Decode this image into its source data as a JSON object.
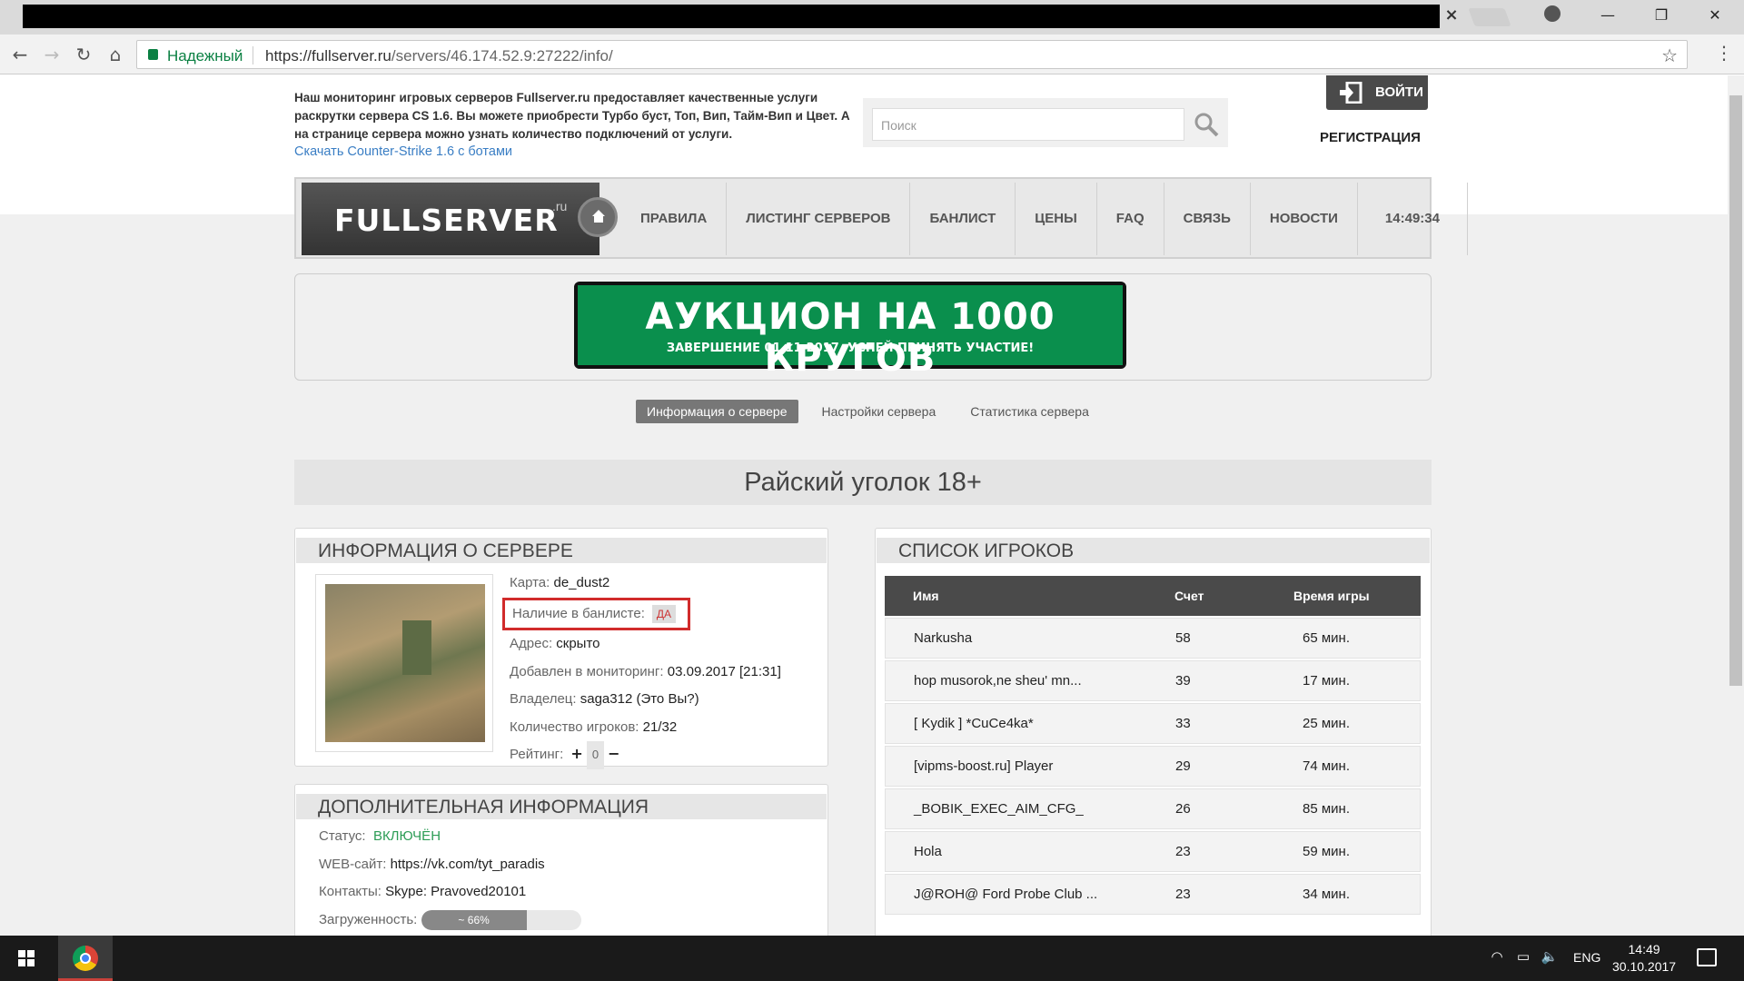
{
  "browser": {
    "secure_label": "Надежный",
    "url_host": "https://fullserver.ru",
    "url_path": "/servers/46.174.52.9:27222/info/",
    "tab_close": "×"
  },
  "header": {
    "intro": "Наш мониторинг игровых серверов Fullserver.ru предоставляет качественные услуги раскрутки сервера CS 1.6. Вы можете приобрести Турбо буст, Топ, Вип, Тайм-Вип и Цвет. А на странице сервера можно узнать количество подключений от услуги.",
    "download_link": "Скачать Counter-Strike 1.6 с ботами",
    "search_placeholder": "Поиск",
    "login_label": "ВОЙТИ",
    "register_label": "РЕГИСТРАЦИЯ"
  },
  "nav": {
    "logo": "FULLSERVER",
    "logo_sup": ".ru",
    "items": [
      "ПРАВИЛА",
      "ЛИСТИНГ СЕРВЕРОВ",
      "БАНЛИСТ",
      "ЦЕНЫ",
      "FAQ",
      "СВЯЗЬ",
      "НОВОСТИ"
    ],
    "clock": "14:49:34"
  },
  "banner": {
    "title": "АУКЦИОН НА 1000 КРУГОВ",
    "subtitle": "ЗАВЕРШЕНИЕ 01.11.2017. УСПЕЙ ПРИНЯТЬ УЧАСТИЕ!"
  },
  "tabs": {
    "info": "Информация о сервере",
    "settings": "Настройки сервера",
    "stats": "Статистика сервера"
  },
  "server": {
    "name": "Райский уголок 18+",
    "info_title": "ИНФОРМАЦИЯ О СЕРВЕРЕ",
    "map_label": "Карта:",
    "map": "de_dust2",
    "banlist_label": "Наличие в банлисте:",
    "banlist": "ДА",
    "address_label": "Адрес:",
    "address": "скрыто",
    "added_label": "Добавлен в мониторинг:",
    "added": "03.09.2017 [21:31]",
    "owner_label": "Владелец:",
    "owner": "saga312 (Это Вы?)",
    "players_label": "Количество игроков:",
    "players": "21/32",
    "rating_label": "Рейтинг:",
    "rating": "0"
  },
  "extra": {
    "title": "ДОПОЛНИТЕЛЬНАЯ ИНФОРМАЦИЯ",
    "status_label": "Статус:",
    "status": "ВКЛЮЧЁН",
    "web_label": "WEB-сайт:",
    "web": "https://vk.com/tyt_paradis",
    "contacts_label": "Контакты:",
    "contacts": "Skype: Pravoved20101",
    "load_label": "Загруженность:",
    "load_text": "~ 66%",
    "load_value": 0.66
  },
  "players": {
    "title": "СПИСОК ИГРОКОВ",
    "col_name": "Имя",
    "col_score": "Счет",
    "col_time": "Время игры",
    "rows": [
      {
        "name": "Narkusha",
        "score": "58",
        "time": "65 мин."
      },
      {
        "name": "hop musorok,ne sheu' mn...",
        "score": "39",
        "time": "17 мин."
      },
      {
        "name": "[ Kydik ] *CuCe4ka*",
        "score": "33",
        "time": "25 мин."
      },
      {
        "name": "[vipms-boost.ru] Player",
        "score": "29",
        "time": "74 мин."
      },
      {
        "name": "_BOBIK_EXEC_AIM_CFG_",
        "score": "26",
        "time": "85 мин."
      },
      {
        "name": "Hola",
        "score": "23",
        "time": "59 мин."
      },
      {
        "name": "J@ROH@ Ford Probe Club ...",
        "score": "23",
        "time": "34 мин."
      }
    ]
  },
  "taskbar": {
    "lang": "ENG",
    "time": "14:49",
    "date": "30.10.2017"
  }
}
